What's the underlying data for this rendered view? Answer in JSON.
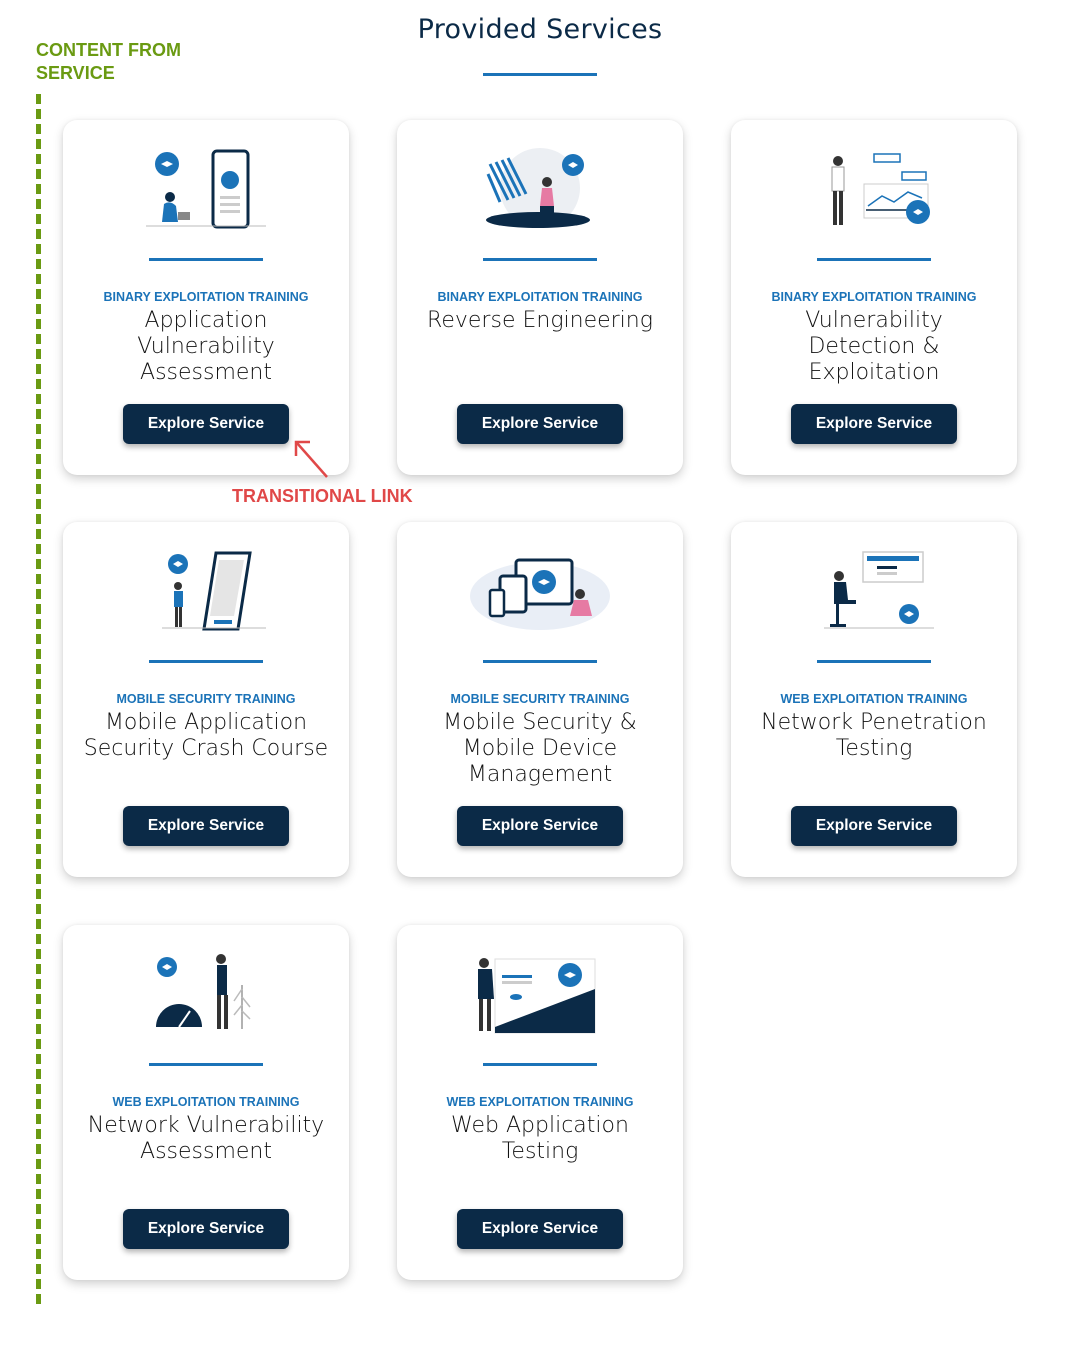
{
  "annotation": {
    "label": "CONTENT FROM SERVICE",
    "transitional_label": "TRANSITIONAL LINK",
    "color_annotation": "#6a9a12",
    "color_transitional": "#e04848"
  },
  "page": {
    "title": "Provided Services"
  },
  "colors": {
    "navy": "#0b2a47",
    "accent": "#1b73b8"
  },
  "cards": [
    {
      "category": "BINARY EXPLOITATION TRAINING",
      "name": "Application Vulnerability Assessment",
      "button": "Explore Service",
      "icon": "person-with-phone-illustration"
    },
    {
      "category": "BINARY EXPLOITATION TRAINING",
      "name": "Reverse Engineering",
      "button": "Explore Service",
      "icon": "person-with-abstract-art-illustration"
    },
    {
      "category": "BINARY EXPLOITATION TRAINING",
      "name": "Vulnerability Detection & Exploitation",
      "button": "Explore Service",
      "icon": "person-with-charts-illustration"
    },
    {
      "category": "MOBILE SECURITY TRAINING",
      "name": "Mobile Application Security Crash Course",
      "button": "Explore Service",
      "icon": "person-with-large-phone-illustration"
    },
    {
      "category": "MOBILE SECURITY TRAINING",
      "name": "Mobile Security & Mobile Device Management",
      "button": "Explore Service",
      "icon": "devices-illustration"
    },
    {
      "category": "WEB EXPLOITATION TRAINING",
      "name": "Network Penetration Testing",
      "button": "Explore Service",
      "icon": "person-at-desk-illustration"
    },
    {
      "category": "WEB EXPLOITATION TRAINING",
      "name": "Network Vulnerability Assessment",
      "button": "Explore Service",
      "icon": "speedometer-illustration"
    },
    {
      "category": "WEB EXPLOITATION TRAINING",
      "name": "Web Application Testing",
      "button": "Explore Service",
      "icon": "person-with-webpage-illustration"
    }
  ]
}
